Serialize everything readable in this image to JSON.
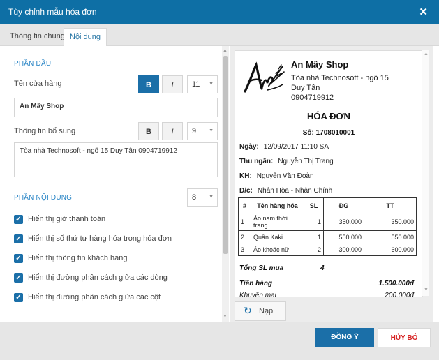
{
  "dialog": {
    "title": "Tùy chỉnh mẫu hóa đơn",
    "close_label": "✕"
  },
  "tabs": [
    {
      "label": "Thông tin chung",
      "active": false
    },
    {
      "label": "Nội dung",
      "active": true
    }
  ],
  "header_section": {
    "title": "PHẦN ĐẦU",
    "store_name_label": "Tên cửa hàng",
    "store_name_bold": "B",
    "store_name_italic": "I",
    "store_name_size": "11",
    "store_name_value": "An Mây Shop",
    "extra_info_label": "Thông tin bổ sung",
    "extra_info_bold": "B",
    "extra_info_italic": "I",
    "extra_info_size": "9",
    "extra_info_value": "Tòa nhà Technosoft - ngõ 15 Duy Tân  0904719912"
  },
  "content_section": {
    "title": "PHẦN NỘI DUNG",
    "font_size": "8",
    "options": [
      {
        "label": "Hiển thị giờ thanh toán",
        "checked": true
      },
      {
        "label": "Hiển thị số thứ tự hàng hóa trong hóa đơn",
        "checked": true
      },
      {
        "label": "Hiển thị thông tin khách hàng",
        "checked": true
      },
      {
        "label": "Hiển thị đường phân cách giữa các dòng",
        "checked": true
      },
      {
        "label": "Hiển thị đường phân cách giữa các cột",
        "checked": true
      }
    ]
  },
  "preview": {
    "shop_name": "An Mây Shop",
    "shop_info": "Tòa nhà Technosoft - ngõ 15 Duy Tân",
    "shop_phone": "0904719912",
    "invoice_title": "HÓA ĐƠN",
    "invoice_no": "Số: 1708010001",
    "date_label": "Ngày:",
    "date_value": "12/09/2017 11:10 SA",
    "cashier_label": "Thu ngân:",
    "cashier_value": "Nguyễn Thị Trang",
    "customer_label": "KH:",
    "customer_value": "Nguyễn Văn Đoàn",
    "address_label": "Đ/c:",
    "address_value": "Nhân Hòa - Nhân Chính",
    "table": {
      "headers": [
        "#",
        "Tên hàng hóa",
        "SL",
        "ĐG",
        "TT"
      ],
      "rows": [
        [
          "1",
          "Áo nam thời trang",
          "1",
          "350.000",
          "350.000"
        ],
        [
          "2",
          "Quần Kaki",
          "1",
          "550.000",
          "550.000"
        ],
        [
          "3",
          "Áo khoác nữ",
          "2",
          "300.000",
          "600.000"
        ]
      ]
    },
    "total_qty_label": "Tổng SL mua",
    "total_qty_value": "4",
    "subtotal_label": "Tiền hàng",
    "subtotal_value": "1.500.000đ",
    "discount_label": "Khuyến mại",
    "discount_value": "200.000đ",
    "reload_label": "Nạp"
  },
  "footer": {
    "ok_label": "ĐỒNG Ý",
    "cancel_label": "HỦY BỎ"
  },
  "colors": {
    "primary": "#1b6fa8",
    "titlebar": "#0e6fa5",
    "danger": "#d62222",
    "section": "#2b86c6"
  },
  "icons": {
    "close": "close-icon",
    "check": "check-icon",
    "reload": "reload-icon",
    "logo": "brand-logo"
  }
}
